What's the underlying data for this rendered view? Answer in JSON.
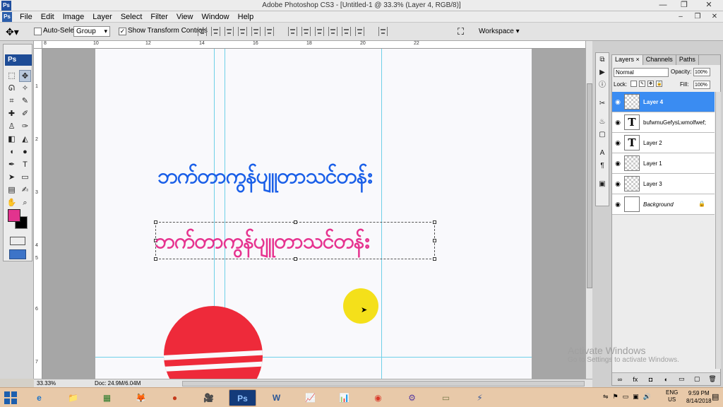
{
  "window": {
    "title": "Adobe Photoshop CS3 - [Untitled-1 @ 33.3% (Layer 4, RGB/8)]",
    "app_icon": "Ps"
  },
  "menu": {
    "items": [
      "File",
      "Edit",
      "Image",
      "Layer",
      "Select",
      "Filter",
      "View",
      "Window",
      "Help"
    ]
  },
  "options": {
    "auto_select_label": "Auto-Select:",
    "auto_select_checked": false,
    "auto_select_mode": "Group",
    "show_transform_label": "Show Transform Controls",
    "show_transform_checked": true,
    "workspace_label": "Workspace ▾"
  },
  "tools": {
    "logo": "Ps",
    "foreground_color": "#e2338e",
    "background_color": "#000000"
  },
  "rulers": {
    "top": [
      "8",
      "10",
      "12",
      "14",
      "16",
      "18",
      "20",
      "22"
    ],
    "left": [
      "1",
      "2",
      "3",
      "4",
      "5",
      "6",
      "7"
    ]
  },
  "canvas": {
    "headline_blue": "ဘက်တာကွန်ပျူတာသင်တန်း",
    "headline_pink": "ဘက်တာကွန်ပျူတာသင်တန်း",
    "blue_color": "#1a5fe8",
    "pink_color": "#e6338f",
    "sun_color": "#ee2a3a"
  },
  "status": {
    "zoom": "33.33%",
    "doc_size": "Doc: 24.9M/6.04M"
  },
  "layers_panel": {
    "tabs": [
      "Layers ×",
      "Channels",
      "Paths"
    ],
    "blend_mode": "Normal",
    "opacity_label": "Opacity:",
    "opacity": "100%",
    "lock_label": "Lock:",
    "fill_label": "Fill:",
    "fill": "100%",
    "layers": [
      {
        "name": "Layer 4",
        "type": "pixel",
        "selected": true
      },
      {
        "name": "bufwmuGefysLwmolfwef;",
        "type": "text",
        "selected": false
      },
      {
        "name": "Layer 2",
        "type": "text",
        "selected": false
      },
      {
        "name": "Layer 1",
        "type": "pixel",
        "selected": false
      },
      {
        "name": "Layer 3",
        "type": "pixel",
        "selected": false
      },
      {
        "name": "Background",
        "type": "background",
        "selected": false,
        "locked": true
      }
    ]
  },
  "watermark": {
    "line1": "Activate Windows",
    "line2": "Go to Settings to activate Windows."
  },
  "taskbar": {
    "apps": [
      "e",
      "📁",
      "▦",
      "🦊",
      "●",
      "🎥",
      "Ps",
      "W",
      "📈",
      "📊",
      "◉",
      "⚙",
      "▭",
      "⚡"
    ],
    "active_app_index": 6,
    "language": "ENG",
    "region": "US",
    "time": "9:59 PM",
    "date": "8/14/2018"
  }
}
